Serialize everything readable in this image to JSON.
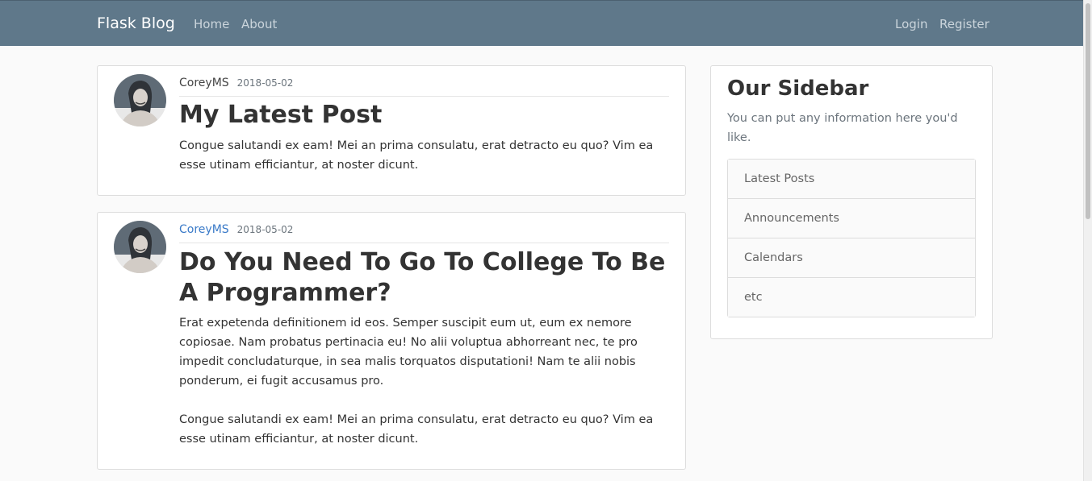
{
  "navbar": {
    "brand": "Flask Blog",
    "left_links": [
      "Home",
      "About"
    ],
    "right_links": [
      "Login",
      "Register"
    ]
  },
  "posts": [
    {
      "author": "CoreyMS",
      "date": "2018-05-02",
      "title": "My Latest Post",
      "body": "Congue salutandi ex eam! Mei an prima consulatu, erat detracto eu quo? Vim ea esse utinam efficiantur, at noster dicunt."
    },
    {
      "author": "CoreyMS",
      "date": "2018-05-02",
      "title": "Do You Need To Go To College To Be A Programmer?",
      "body_paragraphs": [
        "Erat expetenda definitionem id eos. Semper suscipit eum ut, eum ex nemore copiosae. Nam probatus pertinacia eu! No alii voluptua abhorreant nec, te pro impedit concludaturque, in sea malis torquatos disputationi! Nam te alii nobis ponderum, ei fugit accusamus pro.",
        "Congue salutandi ex eam! Mei an prima consulatu, erat detracto eu quo? Vim ea esse utinam efficiantur, at noster dicunt."
      ]
    }
  ],
  "sidebar": {
    "title": "Our Sidebar",
    "text": "You can put any information here you'd like.",
    "items": [
      "Latest Posts",
      "Announcements",
      "Calendars",
      "etc"
    ]
  },
  "colors": {
    "navbar": "#5f788a",
    "link": "#3a7ac8"
  }
}
